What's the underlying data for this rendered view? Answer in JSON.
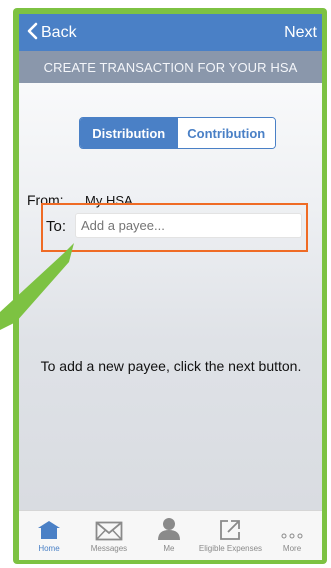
{
  "nav": {
    "back_label": "Back",
    "next_label": "Next"
  },
  "subheader": {
    "title": "CREATE TRANSACTION FOR YOUR HSA"
  },
  "segmented": {
    "distribution_label": "Distribution",
    "contribution_label": "Contribution"
  },
  "form": {
    "from_label": "From:",
    "from_value": "My HSA",
    "to_label": "To:",
    "to_placeholder": "Add a payee..."
  },
  "hint": {
    "text": "To add a new payee, click the next button."
  },
  "tabbar": {
    "items": [
      {
        "label": "Home",
        "icon": "home-icon"
      },
      {
        "label": "Messages",
        "icon": "envelope-icon"
      },
      {
        "label": "Me",
        "icon": "person-icon"
      },
      {
        "label": "Eligible Expenses",
        "icon": "external-link-icon"
      },
      {
        "label": "More",
        "icon": "more-dots-icon"
      }
    ]
  },
  "colors": {
    "frame_green": "#7dc242",
    "nav_blue": "#4a80c6",
    "subheader_gray": "#8a97ab",
    "highlight_orange": "#ef6b25"
  }
}
